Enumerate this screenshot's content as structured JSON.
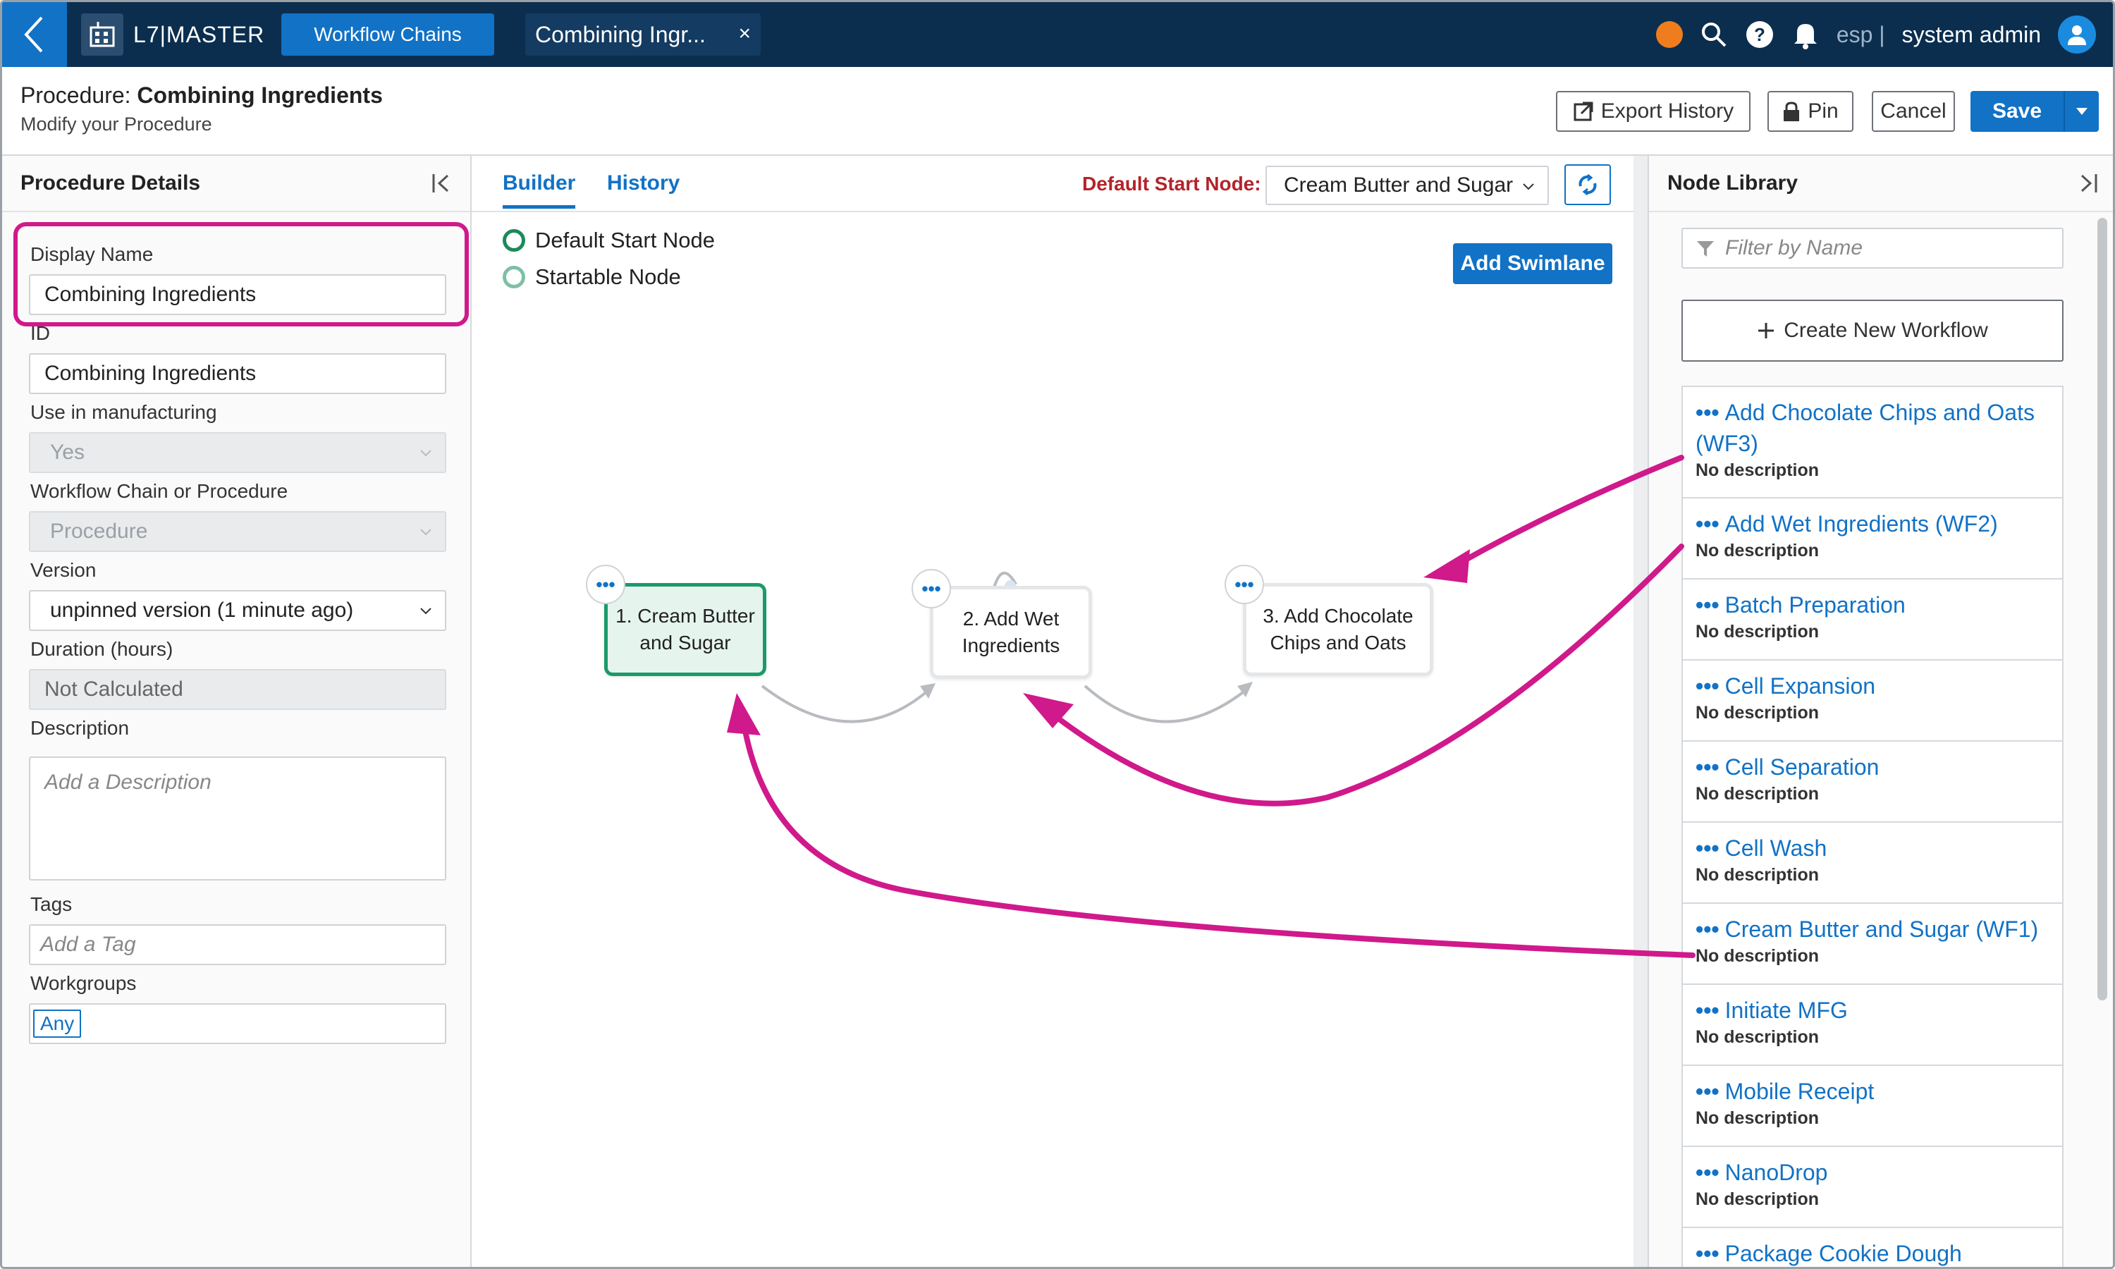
{
  "topbar": {
    "brand": "L7|MASTER",
    "tab_workflow_chains": "Workflow Chains",
    "open_tab": "Combining Ingr...",
    "open_tab_close": "×",
    "lang": "esp |",
    "user": "system admin"
  },
  "procedure": {
    "title_prefix": "Procedure: ",
    "title_name": "Combining Ingredients",
    "subtitle": "Modify your Procedure",
    "export_history": "Export History",
    "pin": "Pin",
    "cancel": "Cancel",
    "save": "Save"
  },
  "details": {
    "header": "Procedure Details",
    "display_name_label": "Display Name",
    "display_name_value": "Combining Ingredients",
    "id_label": "ID",
    "id_value": "Combining Ingredients",
    "manufacturing_label": "Use in manufacturing",
    "manufacturing_value": "Yes",
    "type_label": "Workflow Chain or Procedure",
    "type_value": "Procedure",
    "version_label": "Version",
    "version_value": "unpinned version (1 minute ago)",
    "duration_label": "Duration (hours)",
    "duration_value": "Not Calculated",
    "description_label": "Description",
    "description_placeholder": "Add a Description",
    "tags_label": "Tags",
    "tags_placeholder": "Add a Tag",
    "workgroups_label": "Workgroups",
    "workgroups_value": "Any"
  },
  "builder": {
    "tab_builder": "Builder",
    "tab_history": "History",
    "default_start_label": "Default Start Node:",
    "default_start_value": "Cream Butter and Sugar",
    "legend_default": "Default Start Node",
    "legend_startable": "Startable Node",
    "add_swimlane": "Add Swimlane",
    "nodes": [
      {
        "label": "1. Cream Butter and Sugar"
      },
      {
        "label": "2. Add Wet Ingredients"
      },
      {
        "label": "3. Add Chocolate Chips and Oats"
      }
    ]
  },
  "library": {
    "header": "Node Library",
    "filter_placeholder": "Filter by Name",
    "create_new": "Create New Workflow",
    "items": [
      {
        "name": "Add Chocolate Chips and Oats (WF3)",
        "desc": "No description"
      },
      {
        "name": "Add Wet Ingredients (WF2)",
        "desc": "No description"
      },
      {
        "name": "Batch Preparation",
        "desc": "No description"
      },
      {
        "name": "Cell Expansion",
        "desc": "No description"
      },
      {
        "name": "Cell Separation",
        "desc": "No description"
      },
      {
        "name": "Cell Wash",
        "desc": "No description"
      },
      {
        "name": "Cream Butter and Sugar (WF1)",
        "desc": "No description"
      },
      {
        "name": "Initiate MFG",
        "desc": "No description"
      },
      {
        "name": "Mobile Receipt",
        "desc": "No description"
      },
      {
        "name": "NanoDrop",
        "desc": "No description"
      },
      {
        "name": "Package Cookie Dough",
        "desc": ""
      }
    ]
  },
  "colors": {
    "topbar": "#0b2e4f",
    "accent": "#1172c6",
    "annotation": "#d0198b",
    "start_node_border": "#1b9a6a",
    "default_start_label": "#b4232a"
  }
}
